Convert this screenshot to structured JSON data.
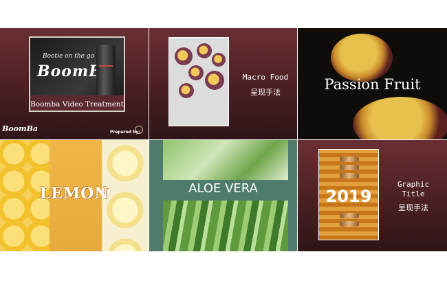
{
  "tiles": {
    "boomba": {
      "tagline": "Bootie on the go",
      "brand": "BoomBa",
      "caption": "Boomba Video Treatment",
      "logo": "BoomBa",
      "prepared": "Prepared by:"
    },
    "macro_food": {
      "title": "Macro Food",
      "subtitle": "呈现手法"
    },
    "passion_fruit": {
      "title": "Passion Fruit"
    },
    "lemon": {
      "word": "LEMON"
    },
    "aloe": {
      "title": "ALOE VERA"
    },
    "graphic": {
      "year": "2019",
      "title_line1": "Graphic",
      "title_line2": "Title",
      "subtitle": "呈现手法"
    }
  },
  "colors": {
    "maroon": "#5a2a2f",
    "aloe_band": "#4f7b6d",
    "lemon": "#f0c62f"
  }
}
